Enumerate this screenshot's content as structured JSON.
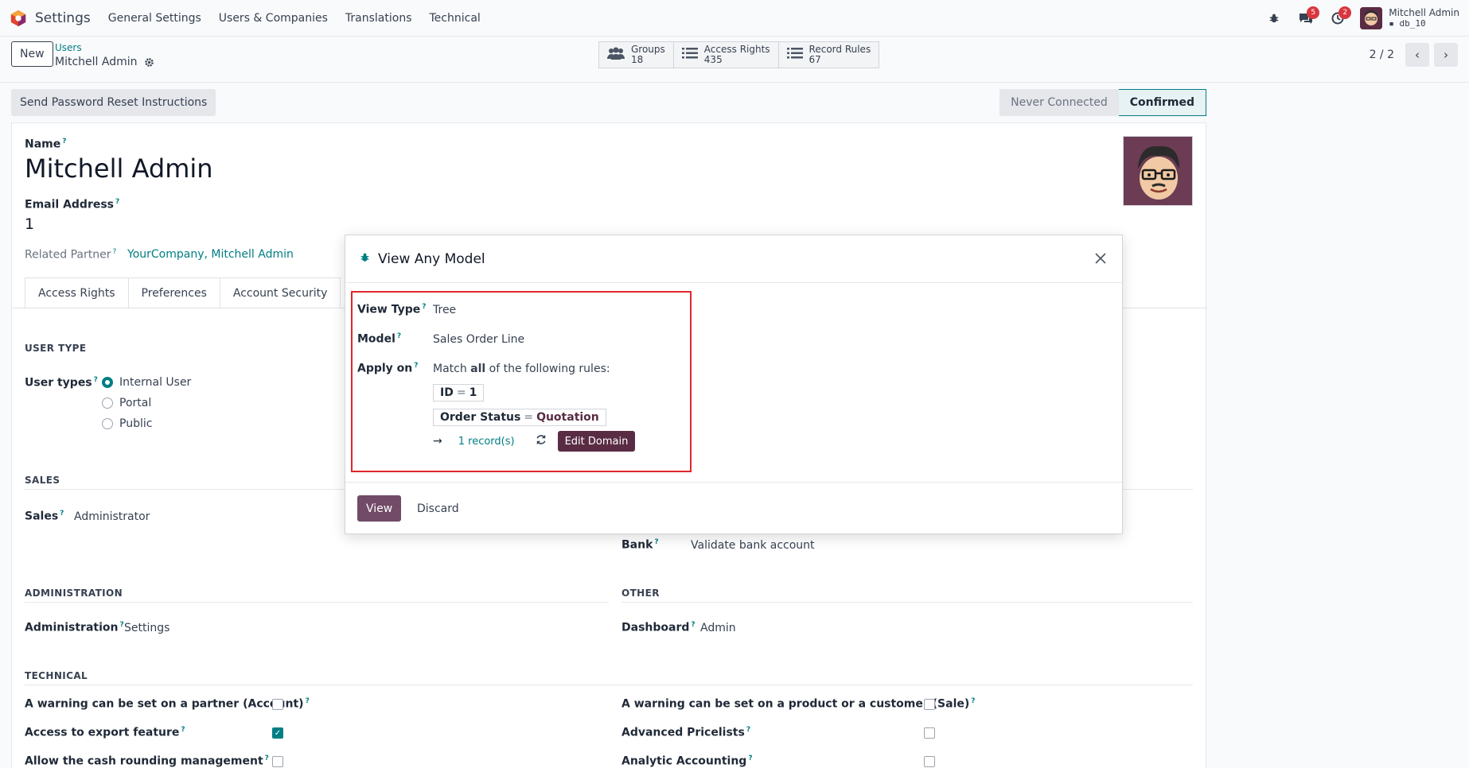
{
  "navbar": {
    "app_name": "Settings",
    "menus": [
      "General Settings",
      "Users & Companies",
      "Translations",
      "Technical"
    ],
    "messages_badge": "5",
    "activities_badge": "2",
    "user_name": "Mitchell Admin",
    "db_name": "db_10"
  },
  "control_panel": {
    "new_label": "New",
    "breadcrumb_parent": "Users",
    "breadcrumb_current": "Mitchell Admin",
    "smart_buttons": [
      {
        "label": "Groups",
        "count": "18"
      },
      {
        "label": "Access Rights",
        "count": "435"
      },
      {
        "label": "Record Rules",
        "count": "67"
      }
    ],
    "pager": "2 / 2"
  },
  "statusbar": {
    "reset_button": "Send Password Reset Instructions",
    "states": [
      "Never Connected",
      "Confirmed"
    ],
    "active_state": "Confirmed"
  },
  "form": {
    "name_label": "Name",
    "name_value": "Mitchell Admin",
    "email_label": "Email Address",
    "email_value": "1",
    "partner_label": "Related Partner",
    "partner_value": "YourCompany, Mitchell Admin",
    "tabs": [
      "Access Rights",
      "Preferences",
      "Account Security"
    ],
    "user_type_section": "USER TYPE",
    "user_types_label": "User types",
    "user_types": [
      "Internal User",
      "Portal",
      "Public"
    ],
    "sales_section": "SALES",
    "sales_label": "Sales",
    "sales_value": "Administrator",
    "bank_label": "Bank",
    "bank_value": "Validate bank account",
    "administration_section": "ADMINISTRATION",
    "administration_label": "Administration",
    "administration_value": "Settings",
    "other_section": "OTHER",
    "dashboard_label": "Dashboard",
    "dashboard_value": "Admin",
    "technical_section": "TECHNICAL",
    "technical_left": [
      {
        "label": "A warning can be set on a partner (Account)",
        "checked": false
      },
      {
        "label": "Access to export feature",
        "checked": true
      },
      {
        "label": "Allow the cash rounding management",
        "checked": false
      }
    ],
    "technical_right": [
      {
        "label": "A warning can be set on a product or a customer (Sale)",
        "checked": false
      },
      {
        "label": "Advanced Pricelists",
        "checked": false
      },
      {
        "label": "Analytic Accounting",
        "checked": false
      }
    ]
  },
  "modal": {
    "title": "View Any Model",
    "view_type_label": "View Type",
    "view_type_value": "Tree",
    "model_label": "Model",
    "model_value": "Sales Order Line",
    "apply_on_label": "Apply on",
    "match_prefix": "Match",
    "match_keyword": "all",
    "match_suffix": "of the following rules:",
    "rules": [
      {
        "field": "ID",
        "operator": "=",
        "value": "1"
      },
      {
        "field": "Order Status",
        "operator": "=",
        "value": "Quotation"
      }
    ],
    "record_count": "1 record(s)",
    "edit_domain_label": "Edit Domain",
    "view_button": "View",
    "discard_button": "Discard"
  },
  "colors": {
    "brand": "#714b67",
    "accent": "#017e84",
    "highlight": "#e0252c"
  }
}
